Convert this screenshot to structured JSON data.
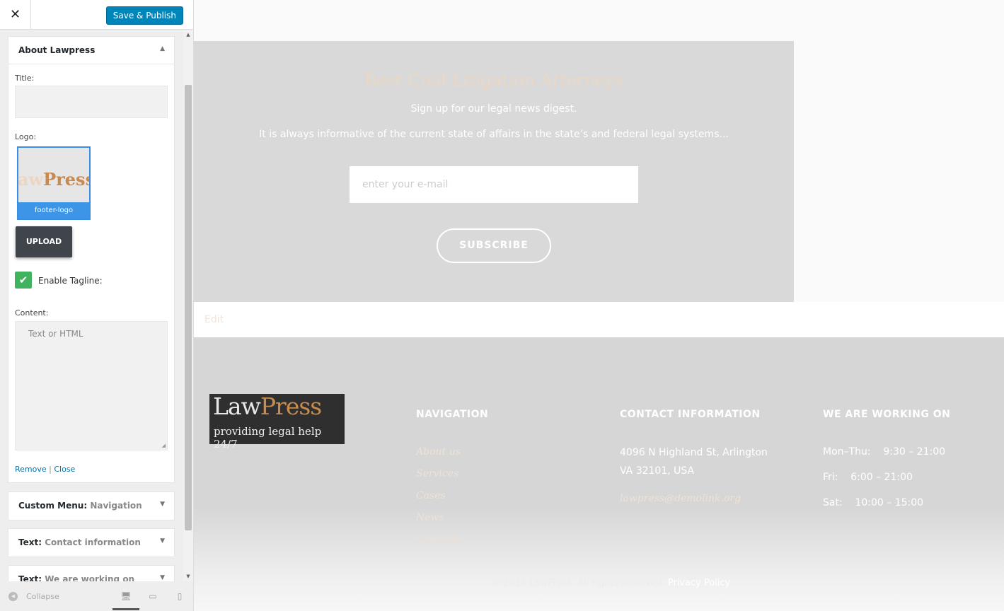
{
  "sidebar": {
    "close_glyph": "✕",
    "save_label": "Save & Publish",
    "widget": {
      "title": "About Lawpress",
      "title_label": "Title:",
      "title_value": "",
      "logo_label": "Logo:",
      "logo_thumb_text_light": "aw",
      "logo_thumb_text_strong": "Press",
      "logo_filename": "footer-logo",
      "upload_label": "UPLOAD",
      "tagline_checked": true,
      "tagline_label": "Enable Tagline:",
      "content_label": "Content:",
      "content_placeholder": "Text or HTML",
      "remove_label": "Remove",
      "separator": "|",
      "close_label": "Close"
    },
    "collapsed_widgets": [
      {
        "type": "Custom Menu:",
        "name": "Navigation"
      },
      {
        "type": "Text:",
        "name": "Contact information"
      },
      {
        "type": "Text:",
        "name": "We are working on"
      }
    ],
    "collapse_label": "Collapse"
  },
  "preview": {
    "newsletter": {
      "title": "Best Civil Litigation Attorneys",
      "subtitle1": "Sign up for our legal news digest.",
      "subtitle2": "It is always informative of the current state of affairs in the state’s and federal legal systems...",
      "email_placeholder": "enter your e-mail",
      "subscribe_label": "SUBSCRIBE"
    },
    "edit_label": "Edit",
    "footer": {
      "logo_name_a": "Law",
      "logo_name_b": "Press",
      "logo_tagline": "providing legal help 24/7",
      "nav_heading": "NAVIGATION",
      "nav_links": [
        "About us",
        "Services",
        "Cases",
        "News",
        "Contacts"
      ],
      "contact_heading": "CONTACT INFORMATION",
      "address_line1": "4096 N Highland St, Arlington",
      "address_line2": "VA 32101, USA",
      "email": "lawpress@demolink.org",
      "hours_heading": "WE ARE WORKING ON",
      "hours": [
        "Mon–Thu:    9:30 – 21:00",
        "Fri:    6:00 – 21:00",
        "Sat:    10:00 – 15:00"
      ],
      "copyright": "© 2016 LawPress. All rights reserved.",
      "privacy_label": "Privacy Policy"
    }
  },
  "colors": {
    "accent": "#0085ba",
    "brand": "#c98c4f",
    "checkbox": "#41b35f"
  }
}
